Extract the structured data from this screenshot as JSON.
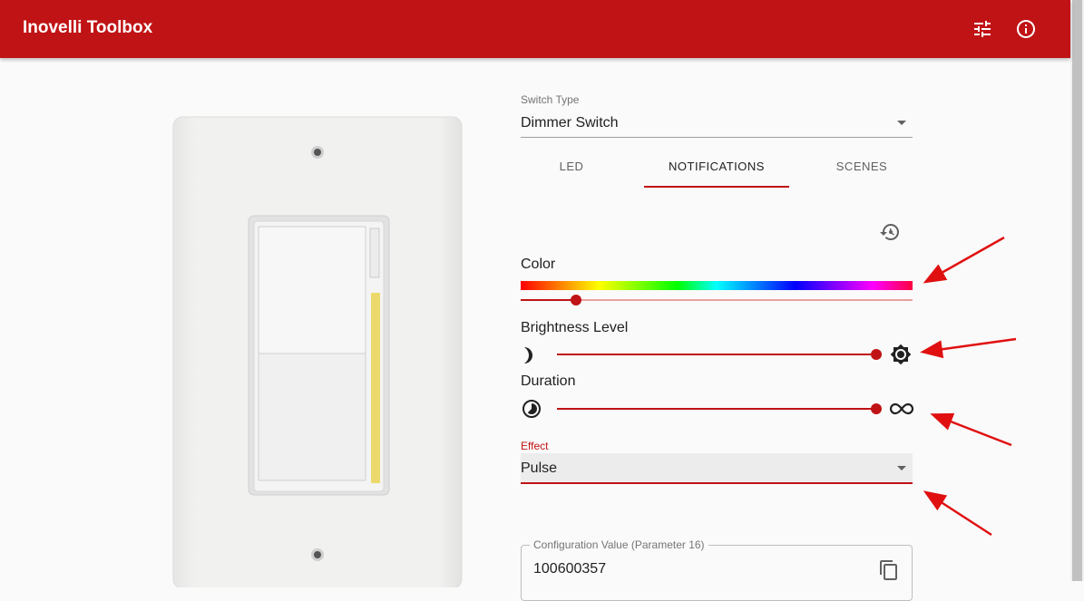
{
  "app": {
    "title": "Inovelli Toolbox"
  },
  "header": {
    "settings_icon": "tune-icon",
    "info_icon": "info-icon"
  },
  "switch_type": {
    "label": "Switch Type",
    "value": "Dimmer Switch"
  },
  "tabs": [
    {
      "label": "LED",
      "active": false
    },
    {
      "label": "NOTIFICATIONS",
      "active": true
    },
    {
      "label": "SCENES",
      "active": false
    }
  ],
  "notifications": {
    "reset_icon": "restore-icon",
    "color": {
      "label": "Color",
      "slider_fraction": 0.14
    },
    "brightness": {
      "label": "Brightness Level",
      "min_icon": "moon-icon",
      "max_icon": "brightness-icon",
      "slider_fraction": 1.0
    },
    "duration": {
      "label": "Duration",
      "min_icon": "timelapse-icon",
      "max_icon": "infinity-icon",
      "slider_fraction": 1.0
    },
    "effect": {
      "label": "Effect",
      "value": "Pulse"
    },
    "config": {
      "label": "Configuration Value (Parameter 16)",
      "value": "100600357",
      "copy_icon": "copy-icon"
    }
  },
  "colors": {
    "brand": "#c01315",
    "annotation_arrow": "#e01010"
  }
}
